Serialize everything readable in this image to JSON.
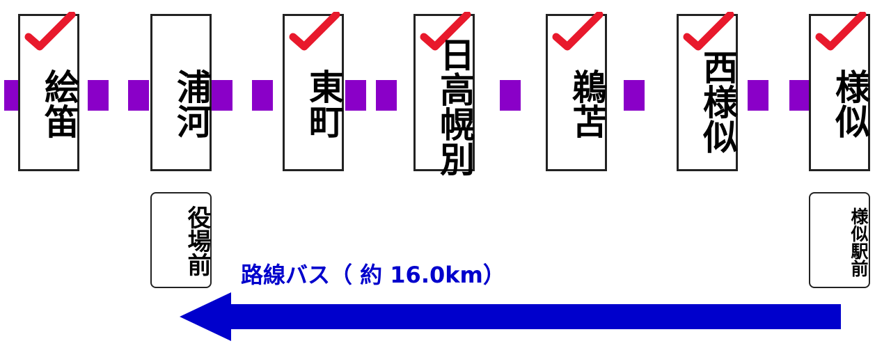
{
  "stations": [
    {
      "name": "絵笛",
      "checked": true
    },
    {
      "name": "浦河",
      "checked": false
    },
    {
      "name": "東町",
      "checked": true
    },
    {
      "name": "日高幌別",
      "checked": true
    },
    {
      "name": "鵜苫",
      "checked": true
    },
    {
      "name": "西様似",
      "checked": true
    },
    {
      "name": "様似",
      "checked": true
    }
  ],
  "bus_stops": {
    "west": "役場前",
    "east": "様似駅前"
  },
  "bus_route_label": "路線バス（ 約 16.0km）",
  "colors": {
    "rail_line": "#8a00c8",
    "check_mark": "#e8192c",
    "bus_arrow": "#0000cc",
    "bus_text": "#0000cc"
  }
}
